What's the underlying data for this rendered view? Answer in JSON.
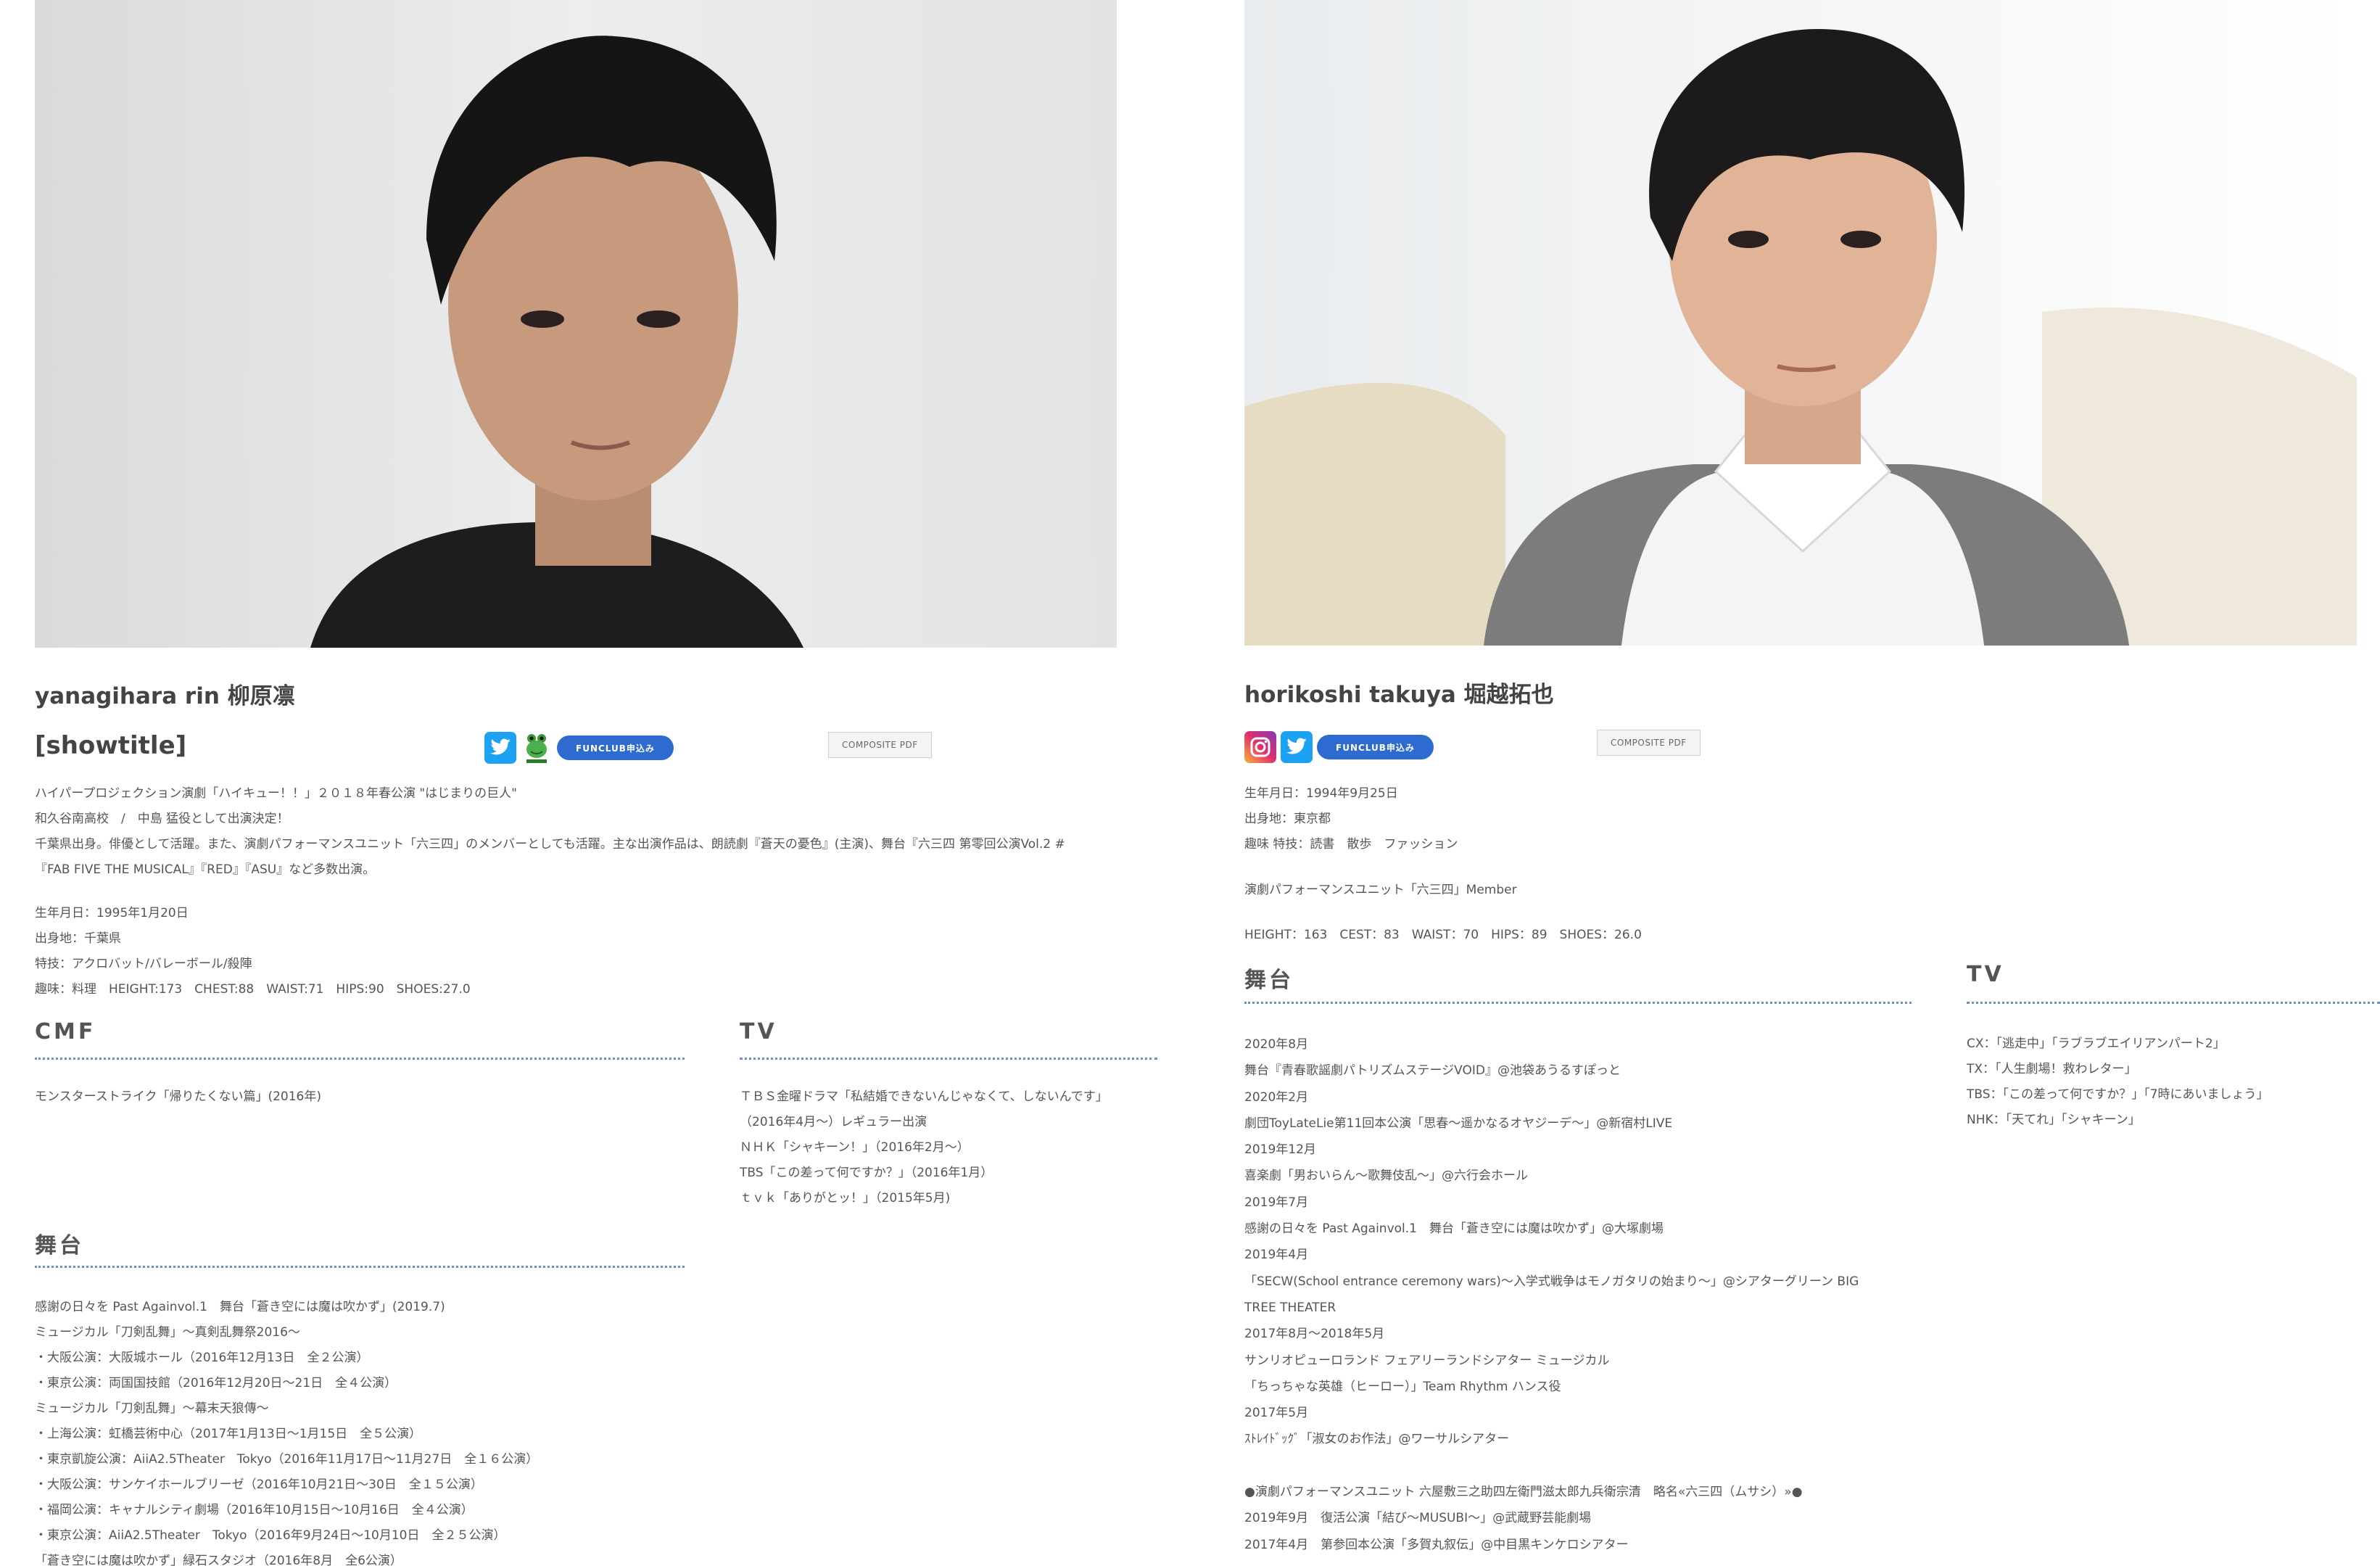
{
  "left": {
    "name": "yanagihara rin 柳原凛",
    "showtitle": "[showtitle]",
    "composite_pdf": "COMPOSITE PDF",
    "fanclub_label": "FUNCLUB申込み",
    "social_icons": [
      "twitter-icon",
      "frog-icon"
    ],
    "intro": [
      "ハイパープロジェクション演劇「ハイキュー！！」２０１８年春公演 \"はじまりの巨人\"",
      "和久谷南高校　/　中島 猛役として出演決定！",
      "千葉県出身。俳優として活躍。また、演劇パフォーマンスユニット「六三四」のメンバーとしても活躍。主な出演作品は、朗読劇『蒼天の憂色』(主演)、舞台『六三四 第零回公演Vol.2 #",
      "『FAB FIVE THE MUSICAL』『RED』『ASU』など多数出演。"
    ],
    "profile": [
      "生年月日：1995年1月20日",
      "出身地：千葉県",
      "特技：アクロバット/バレーボール/殺陣",
      "趣味：料理　HEIGHT:173　CHEST:88　WAIST:71　HIPS:90　SHOES:27.0"
    ],
    "cmf_title": "CMF",
    "cmf_items": [
      "モンスターストライク「帰りたくない篇」(2016年)"
    ],
    "tv_title": "TV",
    "tv_items": [
      "ＴＢＳ金曜ドラマ「私結婚できないんじゃなくて、しないんです」",
      "（2016年4月～）レギュラー出演",
      "ＮＨＫ「シャキーン！」（2016年2月～）",
      "TBS「この差って何ですか？」（2016年1月）",
      "ｔｖｋ「ありがとッ！」（2015年5月)"
    ],
    "stage_title": "舞台",
    "stage_items": [
      "感謝の日々を Past Againvol.1　舞台「蒼き空には魔は吹かず」(2019.7)",
      "ミュージカル「刀剣乱舞」～真剣乱舞祭2016～",
      "・大阪公演：大阪城ホール（2016年12月13日　全２公演）",
      "・東京公演：両国国技館（2016年12月20日～21日　全４公演）",
      "ミュージカル「刀剣乱舞」～幕末天狼傳～",
      "・上海公演：虹橋芸術中心（2017年1月13日～1月15日　全５公演）",
      "・東京凱旋公演：AiiA2.5Theater　Tokyo（2016年11月17日～11月27日　全１６公演）",
      "・大阪公演：サンケイホールブリーゼ（2016年10月21日～30日　全１５公演）",
      "・福岡公演：キャナルシティ劇場（2016年10月15日～10月16日　全４公演）",
      "・東京公演：AiiA2.5Theater　Tokyo（2016年9月24日～10月10日　全２５公演）",
      "「蒼き空には魔は吹かず」緑石スタジオ（2016年8月　全6公演）"
    ]
  },
  "right": {
    "name": "horikoshi takuya 堀越拓也",
    "composite_pdf": "COMPOSITE PDF",
    "fanclub_label": "FUNCLUB申込み",
    "social_icons": [
      "instagram-icon",
      "twitter-icon"
    ],
    "profile": [
      "生年月日：1994年9月25日",
      "出身地：東京都",
      "趣味 特技：読書　散歩　ファッション"
    ],
    "unit": "演劇パフォーマンスユニット「六三四」Member",
    "measurements": "HEIGHT：163　CEST：83　WAIST：70　HIPS：89　SHOES：26.0",
    "stage_title": "舞台",
    "stage_items": [
      "2020年8月",
      "舞台『青春歌謡劇パトリズムステージVOID』@池袋あうるすぽっと",
      "2020年2月",
      "劇団ToyLateLie第11回本公演「思春～遥かなるオヤジーデ～」@新宿村LIVE",
      "2019年12月",
      "喜楽劇「男おいらん～歌舞伎乱～」@六行会ホール",
      "2019年7月",
      "感謝の日々を Past Againvol.1　舞台「蒼き空には魔は吹かず」@大塚劇場",
      "2019年4月",
      "「SECW(School entrance ceremony wars)～入学式戦争はモノガタリの始まり～」@シアターグリーン BIG",
      "TREE THEATER",
      "2017年8月～2018年5月",
      "サンリオピューロランド フェアリーランドシアター ミュージカル",
      "「ちっちゃな英雄（ヒーロー）」Team Rhythm ハンス役",
      "2017年5月",
      "ｽﾄﾚｲﾄﾞｯｸﾞ「淑女のお作法」@ワーサルシアター",
      "",
      "●演劇パフォーマンスユニット 六屋敷三之助四左衛門滋太郎九兵衛宗清　略名«六三四（ムサシ）»●",
      "2019年9月　復活公演「結び～MUSUBI～」@武蔵野芸能劇場",
      "2017年4月　第参回本公演「多賀丸叙伝」@中目黒キンケロシアター"
    ],
    "tv_title": "TV",
    "tv_items": [
      "CX：「逃走中」「ラブラブエイリアンパート2」",
      "TX：「人生劇場！救わレター」",
      "TBS：「この差って何ですか？」「7時にあいましょう」",
      "NHK：「天てれ」「シャキーン」"
    ]
  },
  "colors": {
    "accent_blue": "#2e6bd1",
    "twitter_blue": "#1da1f2",
    "rule_blue": "#6a8fc9",
    "text_gray": "#555555"
  }
}
